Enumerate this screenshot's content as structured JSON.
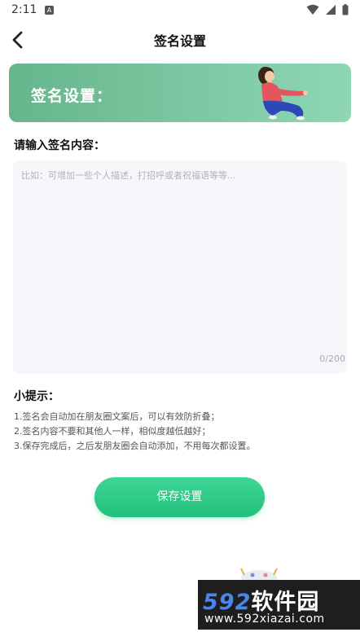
{
  "status_bar": {
    "time": "2:11",
    "notification_glyph": "A",
    "icons": [
      "wifi-icon",
      "signal-icon",
      "battery-icon"
    ]
  },
  "header": {
    "title": "签名设置",
    "back_icon": "chevron-left-icon"
  },
  "banner": {
    "title": "签名设置：",
    "illustration": "woman-sitting-illustration"
  },
  "form": {
    "label": "请输入签名内容：",
    "placeholder": "比如：可增加一些个人描述，打招呼或者祝福语等等...",
    "value": "",
    "counter": "0/200"
  },
  "tips": {
    "title": "小提示：",
    "items": [
      "1.签名会自动加在朋友圈文案后，可以有效防折叠；",
      "2.签名内容不要和其他人一样，相似度越低越好；",
      "3.保存完成后，之后发朋友圈会自动添加，不用每次都设置。"
    ]
  },
  "actions": {
    "save_label": "保存设置"
  },
  "watermark": {
    "number": "592",
    "cn_text": "软件园",
    "url": "www.592xiazai.com"
  },
  "colors": {
    "banner_start": "#66b58c",
    "banner_end": "#8fd6b5",
    "button_top": "#3fd695",
    "button_bottom": "#22c07b",
    "input_bg": "#f6f7fa"
  }
}
